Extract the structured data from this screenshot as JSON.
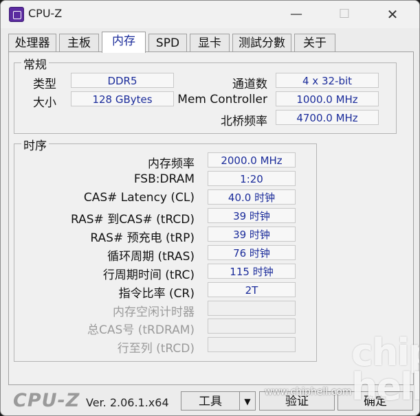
{
  "window": {
    "title": "CPU-Z",
    "minimize": "—",
    "maximize": "☐",
    "close": "✕"
  },
  "tabs": [
    {
      "label": "处理器",
      "active": false
    },
    {
      "label": "主板",
      "active": false
    },
    {
      "label": "内存",
      "active": true
    },
    {
      "label": "SPD",
      "active": false
    },
    {
      "label": "显卡",
      "active": false
    },
    {
      "label": "测試分數",
      "active": false
    },
    {
      "label": "关于",
      "active": false
    }
  ],
  "general": {
    "title": "常规",
    "type_label": "类型",
    "type_value": "DDR5",
    "size_label": "大小",
    "size_value": "128 GBytes",
    "channels_label": "通道数",
    "channels_value": "4 x 32-bit",
    "memctrl_label": "Mem Controller",
    "memctrl_value": "1000.0 MHz",
    "nb_label": "北桥频率",
    "nb_value": "4700.0 MHz"
  },
  "timings": {
    "title": "时序",
    "rows": [
      {
        "label": "内存频率",
        "value": "2000.0 MHz",
        "enabled": true
      },
      {
        "label": "FSB:DRAM",
        "value": "1:20",
        "enabled": true
      },
      {
        "label": "CAS# Latency (CL)",
        "value": "40.0 时钟",
        "enabled": true
      },
      {
        "label": "RAS# 到CAS# (tRCD)",
        "value": "39 时钟",
        "enabled": true
      },
      {
        "label": "RAS# 预充电 (tRP)",
        "value": "39 时钟",
        "enabled": true
      },
      {
        "label": "循环周期 (tRAS)",
        "value": "76 时钟",
        "enabled": true
      },
      {
        "label": "行周期时间 (tRC)",
        "value": "115 时钟",
        "enabled": true
      },
      {
        "label": "指令比率 (CR)",
        "value": "2T",
        "enabled": true
      },
      {
        "label": "内存空闲计时器",
        "value": "",
        "enabled": false
      },
      {
        "label": "总CAS号 (tRDRAM)",
        "value": "",
        "enabled": false
      },
      {
        "label": "行至列 (tRCD)",
        "value": "",
        "enabled": false
      }
    ]
  },
  "footer": {
    "brand": "CPU-Z",
    "version": "Ver. 2.06.1.x64",
    "tools_label": "工具",
    "tools_dropdown": "▼",
    "validate_label": "验证",
    "ok_label": "确定"
  },
  "watermark": {
    "big": "chip hell",
    "url": "www.chiphell.com"
  }
}
